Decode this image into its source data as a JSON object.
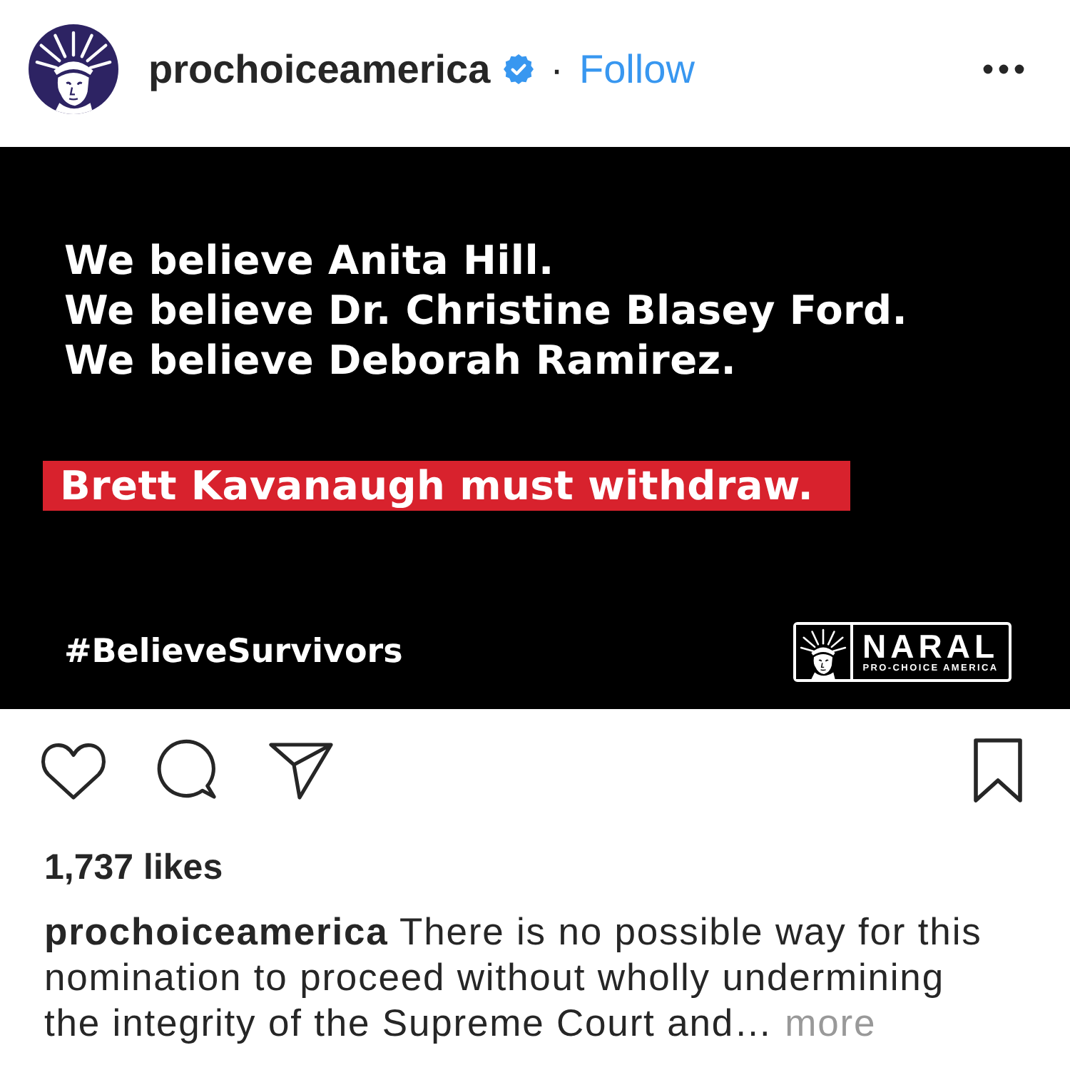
{
  "header": {
    "username": "prochoiceamerica",
    "verified": true,
    "separator": "·",
    "follow": "Follow"
  },
  "post_image": {
    "lines": [
      "We believe Anita Hill.",
      "We believe Dr. Christine Blasey Ford.",
      "We believe Deborah Ramirez."
    ],
    "demand": "Brett Kavanaugh must withdraw.",
    "hashtag": "#BelieveSurvivors",
    "logo": {
      "name": "NARAL",
      "tagline": "PRO-CHOICE AMERICA"
    }
  },
  "actions": {
    "liked": false,
    "saved": false
  },
  "likes": "1,737 likes",
  "caption": {
    "username": "prochoiceamerica",
    "text": "There is no possible way for this nomination to proceed without wholly undermining the integrity of the Supreme Court and…",
    "more": "more"
  }
}
